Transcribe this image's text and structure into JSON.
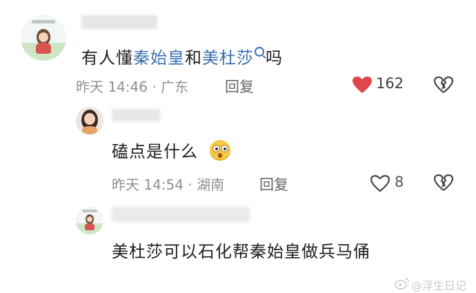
{
  "comments": [
    {
      "text_parts": [
        "有人懂",
        "秦始皇",
        "和",
        "美杜莎",
        "吗"
      ],
      "meta": "昨天 14:46 · 广东",
      "reply_label": "回复",
      "like_count": "162",
      "liked": true
    },
    {
      "text": "磕点是什么",
      "meta": "昨天 14:54 · 湖南",
      "reply_label": "回复",
      "like_count": "8",
      "liked": false
    },
    {
      "text": "美杜莎可以石化帮秦始皇做兵马俑"
    }
  ],
  "watermark": "@浮生日记",
  "colors": {
    "link": "#3a6fb0",
    "like_active": "#e0474c",
    "meta": "#8f8f8f"
  },
  "icons": [
    "heart-icon",
    "broken-heart-icon",
    "search-mark-icon",
    "weibo-logo-icon"
  ]
}
